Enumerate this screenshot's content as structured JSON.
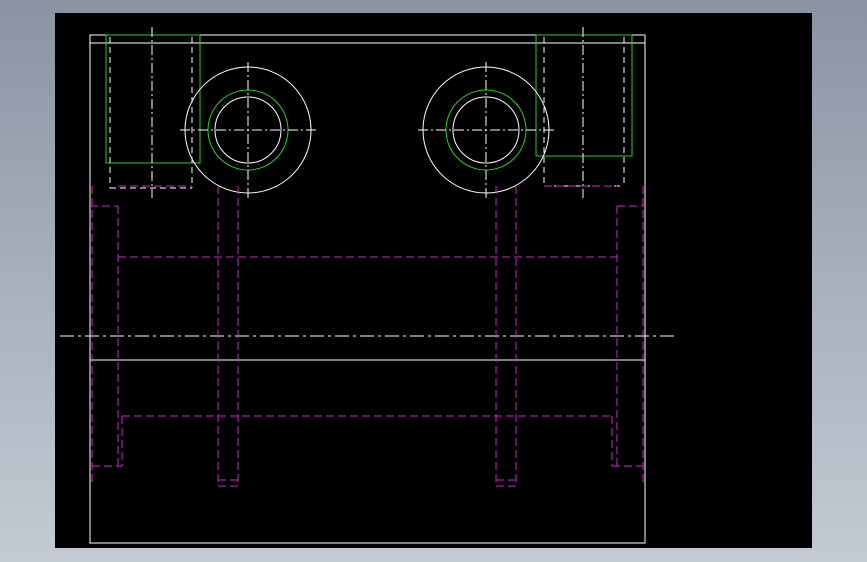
{
  "colors": {
    "background_gradient_top": "#8a93a2",
    "background_gradient_bottom": "#c4cad3",
    "viewport": "#000000",
    "outline": "#ffffff",
    "hidden_lines": "#d21fd2",
    "visible_green": "#22d022",
    "centerlines": "#ffffff"
  },
  "drawing": {
    "description_elements": [
      "outer-rectangle",
      "counterbore-hole-left",
      "counterbore-hole-right",
      "pocket-left",
      "pocket-right",
      "hidden-bolt-holes",
      "horizontal-centerline"
    ]
  }
}
